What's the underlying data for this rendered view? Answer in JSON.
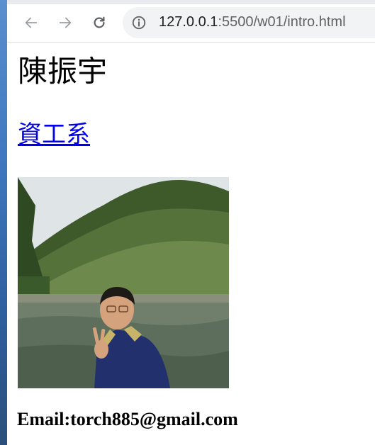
{
  "browser": {
    "address_host": "127.0.0.1",
    "address_path": ":5500/w01/intro.html"
  },
  "page": {
    "name": "陳振宇",
    "department_link": "資工系",
    "email": "Email:torch885@gmail.com"
  },
  "colors": {
    "link": "#0000ee",
    "toolbar_icon": "#5f6368"
  },
  "icons": {
    "back": "back-arrow-icon",
    "forward": "forward-arrow-icon",
    "reload": "reload-icon",
    "site_info": "info-icon"
  }
}
